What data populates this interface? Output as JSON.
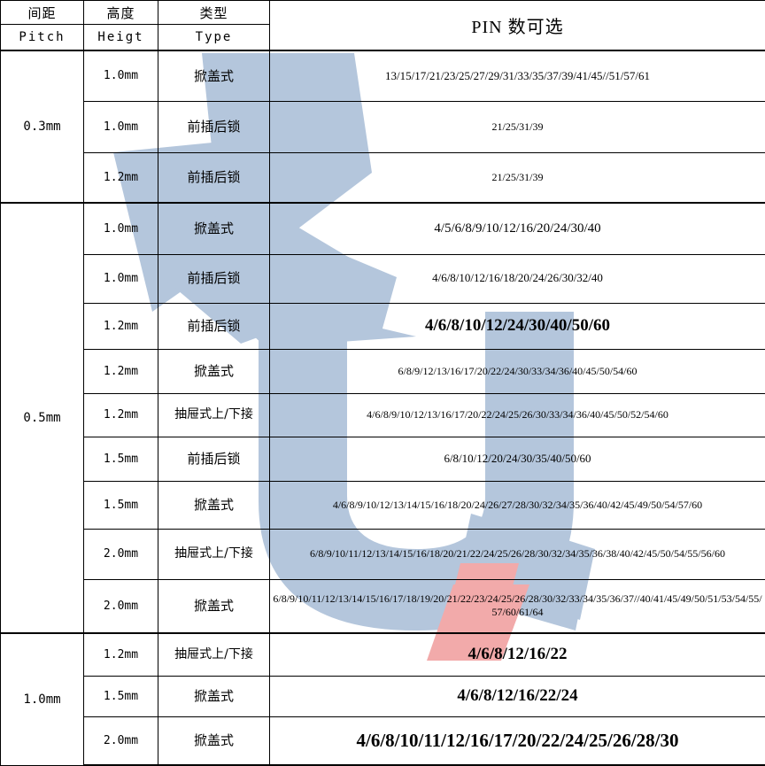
{
  "table": {
    "headers_cn": {
      "pitch": "间距",
      "height": "高度",
      "type": "类型",
      "pin": "PIN 数可选"
    },
    "headers_en": {
      "pitch": "Pitch",
      "height": "Heigt",
      "type": "Type"
    },
    "groups": [
      {
        "pitch": "0.3mm",
        "rows": [
          {
            "height": "1.0mm",
            "type": "掀盖式",
            "pin": "13/15/17/21/23/25/27/29/31/33/35/37/39/41/45//51/57/61",
            "size": "s-md"
          },
          {
            "height": "1.0mm",
            "type": "前插后锁",
            "pin": "21/25/31/39",
            "size": "s-sm"
          },
          {
            "height": "1.2mm",
            "type": "前插后锁",
            "pin": "21/25/31/39",
            "size": "s-sm"
          }
        ]
      },
      {
        "pitch": "0.5mm",
        "rows": [
          {
            "height": "1.0mm",
            "type": "掀盖式",
            "pin": "4/5/6/8/9/10/12/16/20/24/30/40",
            "size": "s-lg"
          },
          {
            "height": "1.0mm",
            "type": "前插后锁",
            "pin": "4/6/8/10/12/16/18/20/24/26/30/32/40",
            "size": "s-md"
          },
          {
            "height": "1.2mm",
            "type": "前插后锁",
            "pin": "4/6/8/10/12/24/30/40/50/60",
            "size": "s-xl"
          },
          {
            "height": "1.2mm",
            "type": "掀盖式",
            "pin": "6/8/9/12/13/16/17/20/22/24/30/33/34/36/40/45/50/54/60",
            "size": "s-sm"
          },
          {
            "height": "1.2mm",
            "type": "抽屉式上/下接",
            "pin": "4/6/8/9/10/12/13/16/17/20/22/24/25/26/30/33/34/36/40/45/50/52/54/60",
            "size": "s-sm"
          },
          {
            "height": "1.5mm",
            "type": "前插后锁",
            "pin": "6/8/10/12/20/24/30/35/40/50/60",
            "size": "s-md"
          },
          {
            "height": "1.5mm",
            "type": "掀盖式",
            "pin": "4/6/8/9/10/12/13/14/15/16/18/20/24/26/27/28/30/32/34/35/36/40/42/45/49/50/54/57/60",
            "size": "s-sm"
          },
          {
            "height": "2.0mm",
            "type": "抽屉式上/下接",
            "pin": "6/8/9/10/11/12/13/14/15/16/18/20/21/22/24/25/26/28/30/32/34/35/36/38/40/42/45/50/54/55/56/60",
            "size": "s-sm"
          },
          {
            "height": "2.0mm",
            "type": "掀盖式",
            "pin": "6/8/9/10/11/12/13/14/15/16/17/18/19/20/21/22/23/24/25/26/28/30/32/33/34/35/36/37//40/41/45/49/50/51/53/54/55/57/60/61/64",
            "size": "s-sm"
          }
        ]
      },
      {
        "pitch": "1.0mm",
        "rows": [
          {
            "height": "1.2mm",
            "type": "抽屉式上/下接",
            "pin": "4/6/8/12/16/22",
            "size": "s-xl"
          },
          {
            "height": "1.5mm",
            "type": "掀盖式",
            "pin": "4/6/8/12/16/22/24",
            "size": "s-xl"
          },
          {
            "height": "2.0mm",
            "type": "掀盖式",
            "pin": "4/6/8/10/11/12/16/17/20/22/24/25/26/28/30",
            "size": "s-xxl"
          }
        ]
      }
    ]
  },
  "watermark": {
    "blue_color": "#b4c6dc",
    "pink_color": "#f2aaaa",
    "logo_letter": "U"
  }
}
